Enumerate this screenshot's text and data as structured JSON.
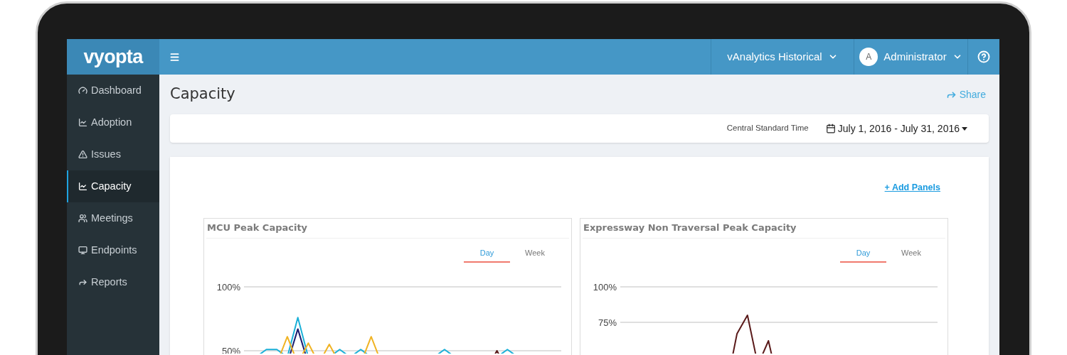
{
  "header": {
    "logo": "vyopta",
    "product_menu": "vAnalytics Historical",
    "user": {
      "avatar_initial": "A",
      "name": "Administrator"
    }
  },
  "sidebar": {
    "items": [
      {
        "label": "Dashboard",
        "selected": false
      },
      {
        "label": "Adoption",
        "selected": false
      },
      {
        "label": "Issues",
        "selected": false
      },
      {
        "label": "Capacity",
        "selected": true
      },
      {
        "label": "Meetings",
        "selected": false
      },
      {
        "label": "Endpoints",
        "selected": false
      },
      {
        "label": "Reports",
        "selected": false
      }
    ]
  },
  "page": {
    "title": "Capacity",
    "share": "Share",
    "timezone": "Central Standard Time",
    "date_range": "July 1, 2016 - July 31, 2016",
    "add_panels": "+ Add Panels"
  },
  "panels": [
    {
      "title": "MCU Peak Capacity",
      "tabs": [
        {
          "label": "Day",
          "selected": true
        },
        {
          "label": "Week",
          "selected": false
        }
      ],
      "y_axis_labels": [
        "100%",
        "50%"
      ]
    },
    {
      "title": "Expressway Non Traversal Peak Capacity",
      "tabs": [
        {
          "label": "Day",
          "selected": true
        },
        {
          "label": "Week",
          "selected": false
        }
      ],
      "y_axis_labels": [
        "100%",
        "75%"
      ]
    }
  ]
}
